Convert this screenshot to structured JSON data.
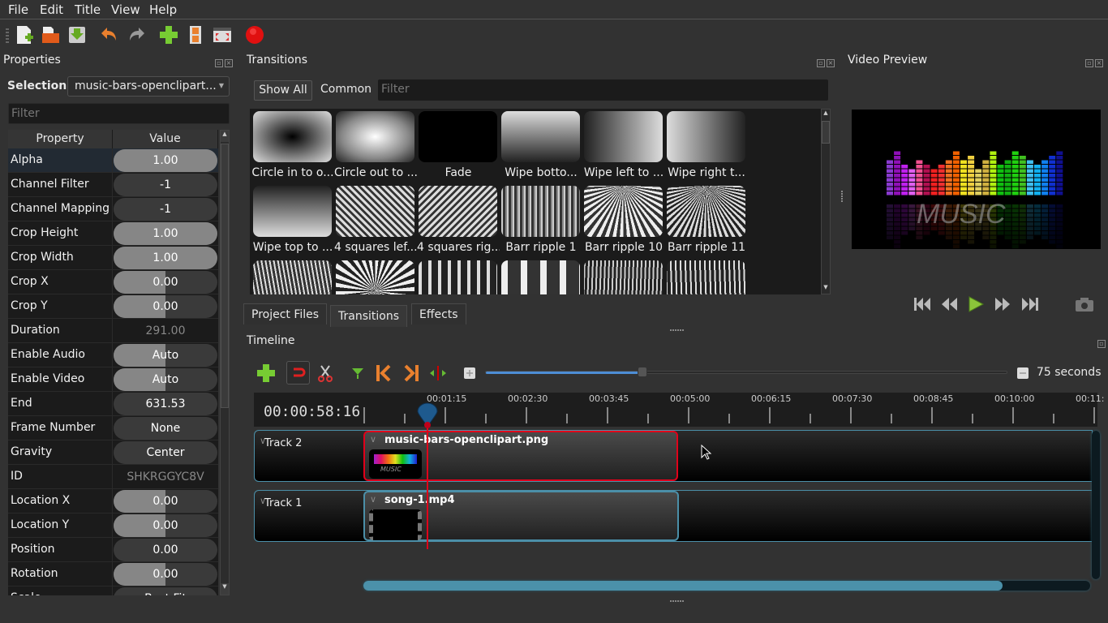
{
  "menu": {
    "items": [
      "File",
      "Edit",
      "Title",
      "View",
      "Help"
    ]
  },
  "toolbar": {
    "icons": [
      "new-project-icon",
      "open-project-icon",
      "save-project-icon",
      "undo-icon",
      "redo-icon",
      "import-files-icon",
      "choose-profile-icon",
      "fullscreen-icon",
      "export-video-icon"
    ]
  },
  "properties": {
    "title": "Properties",
    "selection_label": "Selection:",
    "selection_value": "music-bars-openclipart...",
    "filter_placeholder": "Filter",
    "header_property": "Property",
    "header_value": "Value",
    "rows": [
      {
        "name": "Alpha",
        "value": "1.00",
        "fill": 1.0
      },
      {
        "name": "Channel Filter",
        "value": "-1",
        "fill": 0
      },
      {
        "name": "Channel Mapping",
        "value": "-1",
        "fill": 0
      },
      {
        "name": "Crop Height",
        "value": "1.00",
        "fill": 1.0
      },
      {
        "name": "Crop Width",
        "value": "1.00",
        "fill": 1.0
      },
      {
        "name": "Crop X",
        "value": "0.00",
        "fill": 0.5
      },
      {
        "name": "Crop Y",
        "value": "0.00",
        "fill": 0.5
      },
      {
        "name": "Duration",
        "value": "291.00",
        "fill": null
      },
      {
        "name": "Enable Audio",
        "value": "Auto",
        "fill": 0.5
      },
      {
        "name": "Enable Video",
        "value": "Auto",
        "fill": 0.5
      },
      {
        "name": "End",
        "value": "631.53",
        "fill": 0
      },
      {
        "name": "Frame Number",
        "value": "None",
        "fill": 0
      },
      {
        "name": "Gravity",
        "value": "Center",
        "fill": 0
      },
      {
        "name": "ID",
        "value": "SHKRGGYC8V",
        "fill": null
      },
      {
        "name": "Location X",
        "value": "0.00",
        "fill": 0.5
      },
      {
        "name": "Location Y",
        "value": "0.00",
        "fill": 0.5
      },
      {
        "name": "Position",
        "value": "0.00",
        "fill": 0
      },
      {
        "name": "Rotation",
        "value": "0.00",
        "fill": 0.5
      },
      {
        "name": "Scale",
        "value": "Best Fit",
        "fill": 0
      }
    ]
  },
  "transitions": {
    "title": "Transitions",
    "show_all": "Show All",
    "common": "Common",
    "filter_placeholder": "Filter",
    "items": [
      "Circle in to o...",
      "Circle out to ...",
      "Fade",
      "Wipe botto...",
      "Wipe left to ...",
      "Wipe right t...",
      "Wipe top to ...",
      "4 squares lef...",
      "4 squares rig...",
      "Barr ripple 1",
      "Barr ripple 10",
      "Barr ripple 11",
      "",
      "",
      "",
      "",
      "",
      ""
    ]
  },
  "bottom_tabs": [
    "Project Files",
    "Transitions",
    "Effects"
  ],
  "bottom_tab_active": "Transitions",
  "preview": {
    "title": "Video Preview",
    "image_text": "MUSIC"
  },
  "timeline": {
    "title": "Timeline",
    "zoom_label": "75 seconds",
    "zoom_fraction": 0.3,
    "timecode": "00:00:58:16",
    "ruler_labels": [
      "00:01:15",
      "00:02:30",
      "00:03:45",
      "00:05:00",
      "00:06:15",
      "00:07:30",
      "00:08:45",
      "00:10:00",
      "00:11:"
    ],
    "tracks": [
      {
        "name": "Track 2",
        "clip": "music-bars-openclipart.png",
        "selected": true
      },
      {
        "name": "Track 1",
        "clip": "song-1.mp4",
        "selected": false
      }
    ],
    "hscroll_fraction": 0.88
  },
  "colors": {
    "accent": "#4b91aa",
    "selected_clip": "#e0001a",
    "playhead": "#e0001a"
  }
}
